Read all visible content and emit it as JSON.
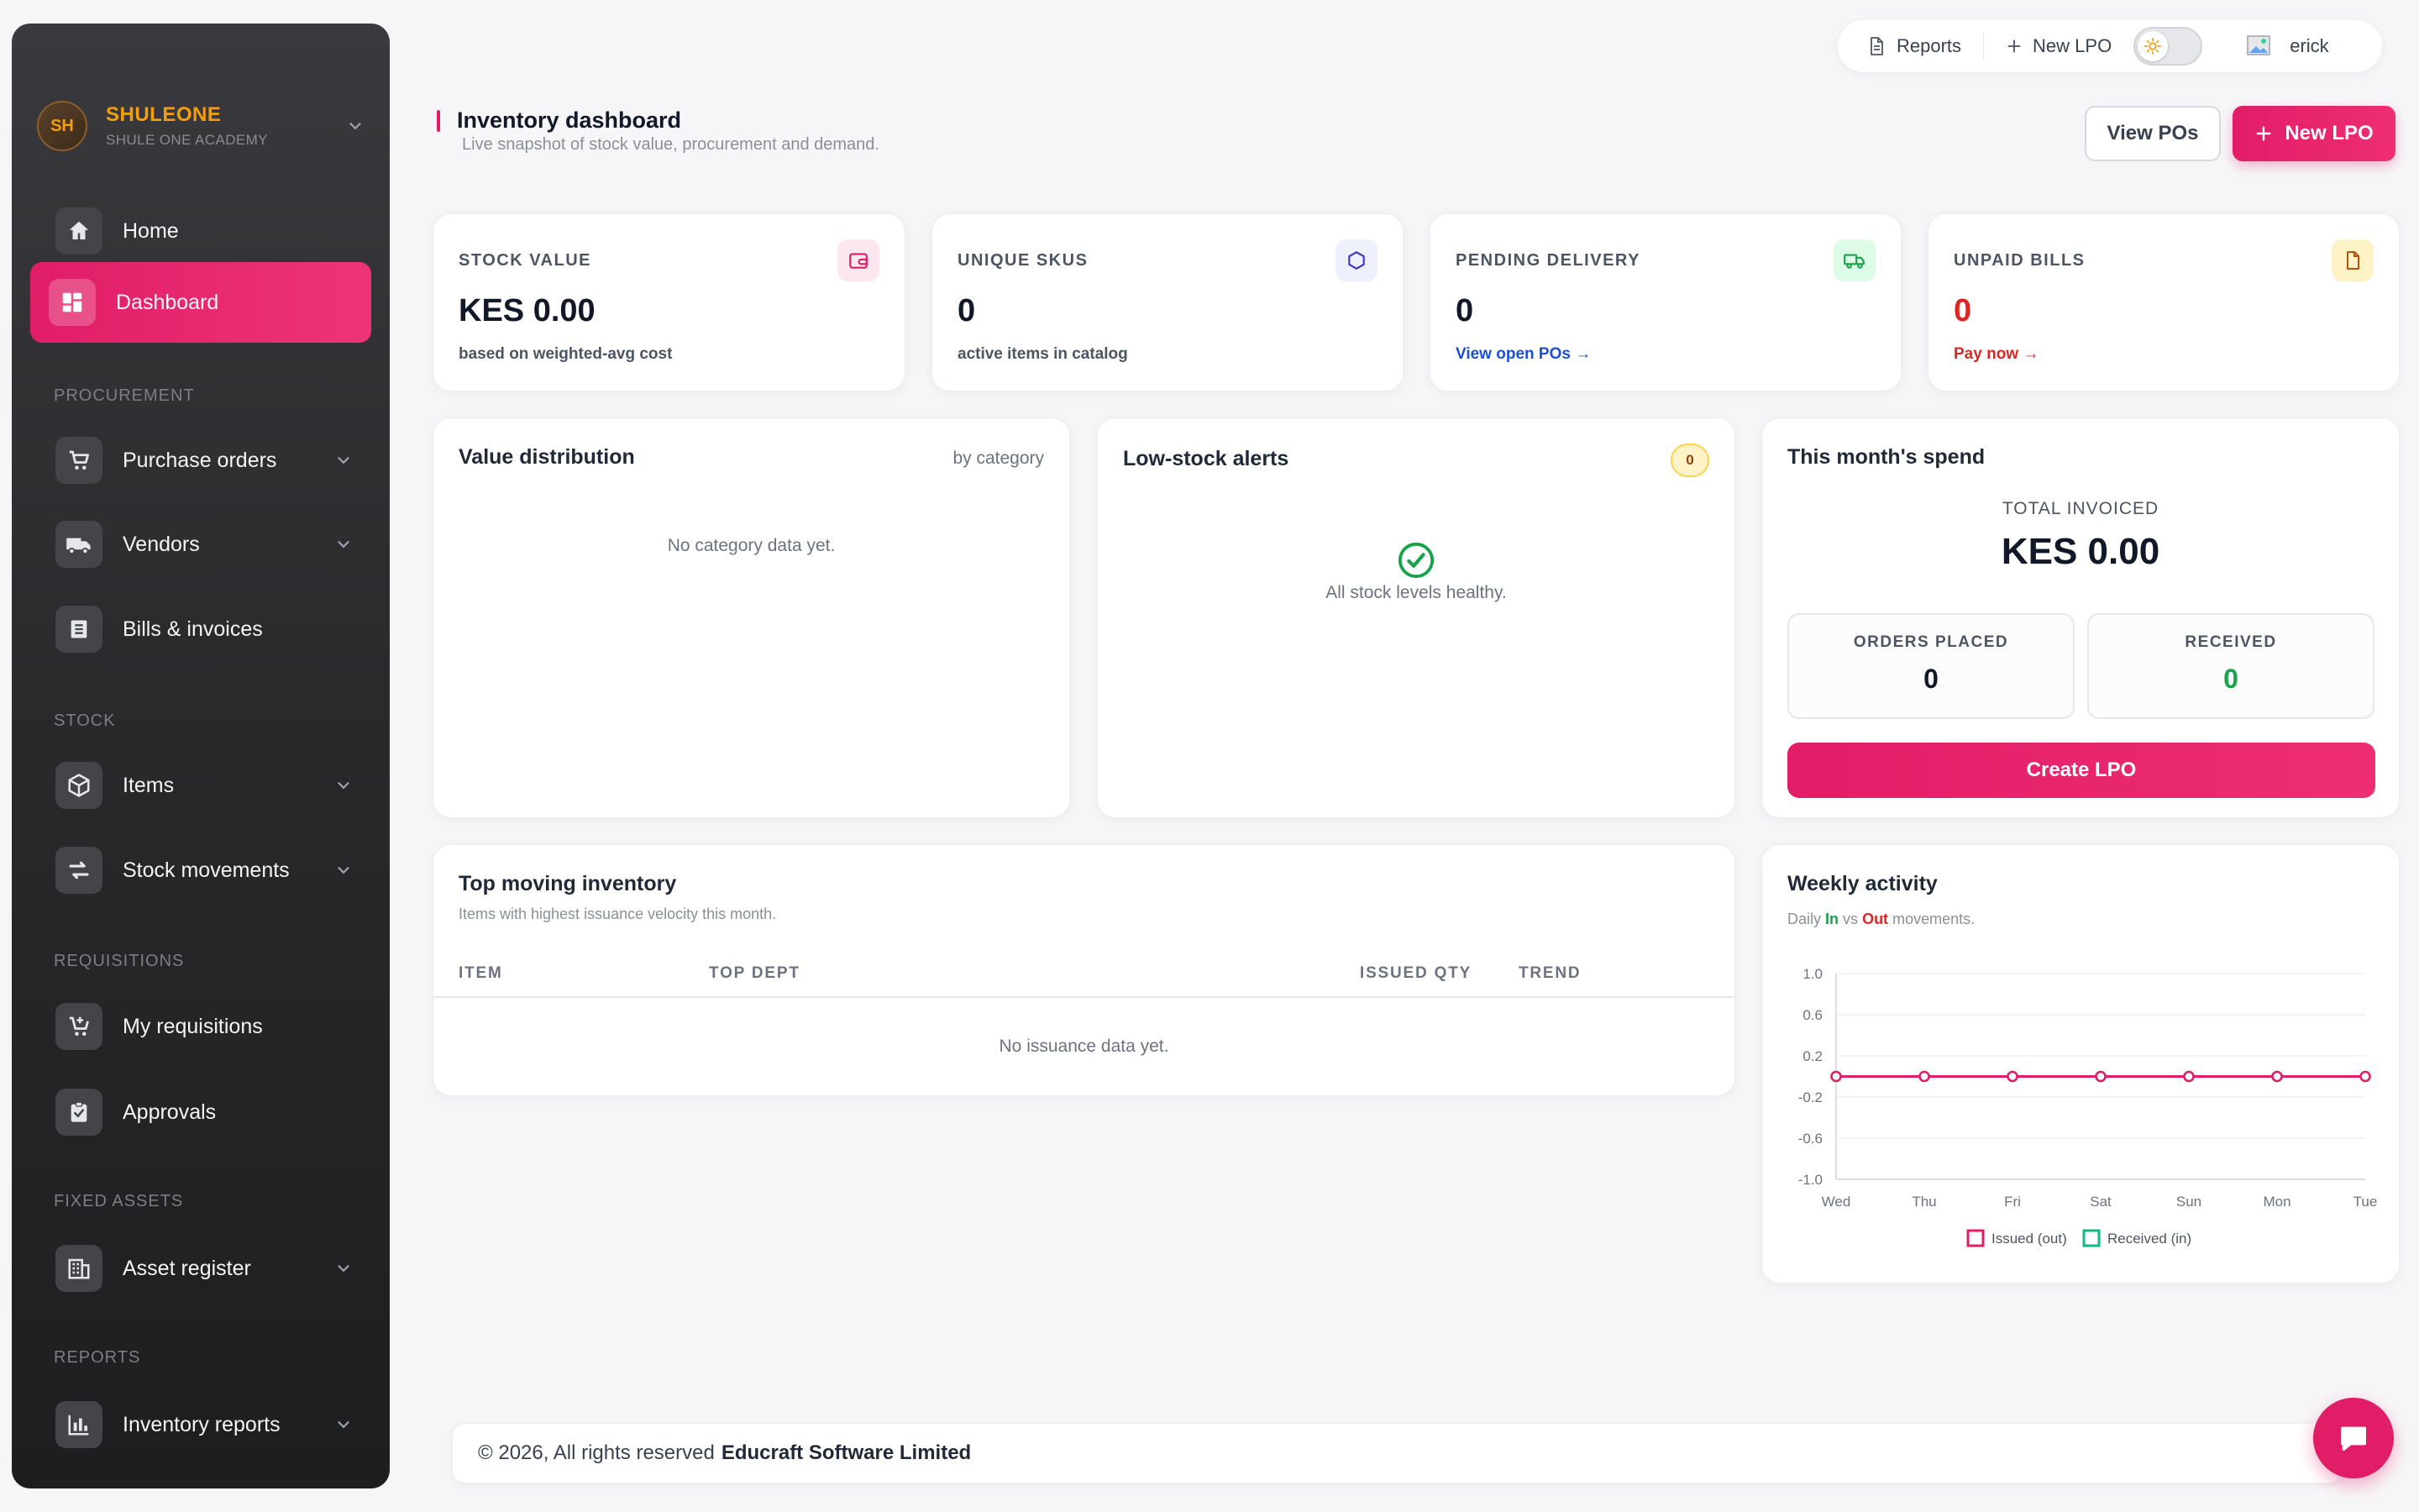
{
  "brand": {
    "avatar": "SH",
    "name": "SHULEONE",
    "sub": "SHULE ONE ACADEMY"
  },
  "sidebar": {
    "home": "Home",
    "dashboard": "Dashboard",
    "sections": {
      "procurement": "PROCUREMENT",
      "stock": "STOCK",
      "requisitions": "REQUISITIONS",
      "fixed_assets": "FIXED ASSETS",
      "reports": "REPORTS"
    },
    "purchase_orders": "Purchase orders",
    "vendors": "Vendors",
    "bills": "Bills & invoices",
    "items": "Items",
    "stock_movements": "Stock movements",
    "my_requisitions": "My requisitions",
    "approvals": "Approvals",
    "asset_register": "Asset register",
    "inventory_reports": "Inventory reports"
  },
  "topbar": {
    "reports": "Reports",
    "new_lpo": "New LPO",
    "user": "erick"
  },
  "header": {
    "title": "Inventory dashboard",
    "subtitle": "Live snapshot of stock value, procurement and demand.",
    "view_pos": "View POs",
    "new_lpo": "New LPO"
  },
  "stats": [
    {
      "label": "STOCK VALUE",
      "value": "KES 0.00",
      "note": "based on weighted-avg cost"
    },
    {
      "label": "UNIQUE SKUS",
      "value": "0",
      "note": "active items in catalog"
    },
    {
      "label": "PENDING DELIVERY",
      "value": "0",
      "note": "View open POs →"
    },
    {
      "label": "UNPAID BILLS",
      "value": "0",
      "note": "Pay now →"
    }
  ],
  "value_distribution": {
    "title": "Value distribution",
    "tag": "by category",
    "empty": "No category data yet."
  },
  "low_stock": {
    "title": "Low-stock alerts",
    "count": "0",
    "empty": "All stock levels healthy."
  },
  "spend": {
    "title": "This month's spend",
    "total_label": "TOTAL INVOICED",
    "total_value": "KES 0.00",
    "orders_label": "ORDERS PLACED",
    "orders_value": "0",
    "received_label": "RECEIVED",
    "received_value": "0",
    "create_btn": "Create LPO"
  },
  "top_moving": {
    "title": "Top moving inventory",
    "subtitle": "Items with highest issuance velocity this month.",
    "columns": [
      "ITEM",
      "TOP DEPT",
      "ISSUED QTY",
      "TREND"
    ],
    "empty": "No issuance data yet."
  },
  "weekly": {
    "title": "Weekly activity",
    "sub_prefix": "Daily",
    "sub_in": "In",
    "sub_vs": "vs",
    "sub_out": "Out",
    "sub_suffix": "movements."
  },
  "chart_data": {
    "type": "line",
    "x": [
      "Wed",
      "Thu",
      "Fri",
      "Sat",
      "Sun",
      "Mon",
      "Tue"
    ],
    "series": [
      {
        "name": "Issued (out)",
        "values": [
          0,
          0,
          0,
          0,
          0,
          0,
          0
        ],
        "color": "#e11d67"
      },
      {
        "name": "Received (in)",
        "values": [
          0,
          0,
          0,
          0,
          0,
          0,
          0
        ],
        "color": "#10b981"
      }
    ],
    "yticks": [
      "1.0",
      "0.6",
      "0.2",
      "-0.2",
      "-0.6",
      "-1.0"
    ],
    "ylim": [
      -1,
      1
    ],
    "legend": "bottom",
    "grid": true
  },
  "footer": {
    "text": "© 2026, All rights reserved",
    "company": "Educraft Software Limited"
  },
  "colors": {
    "accent": "#e11d67",
    "success": "#16a34a",
    "danger": "#dc2626",
    "link": "#1d4ed8"
  }
}
